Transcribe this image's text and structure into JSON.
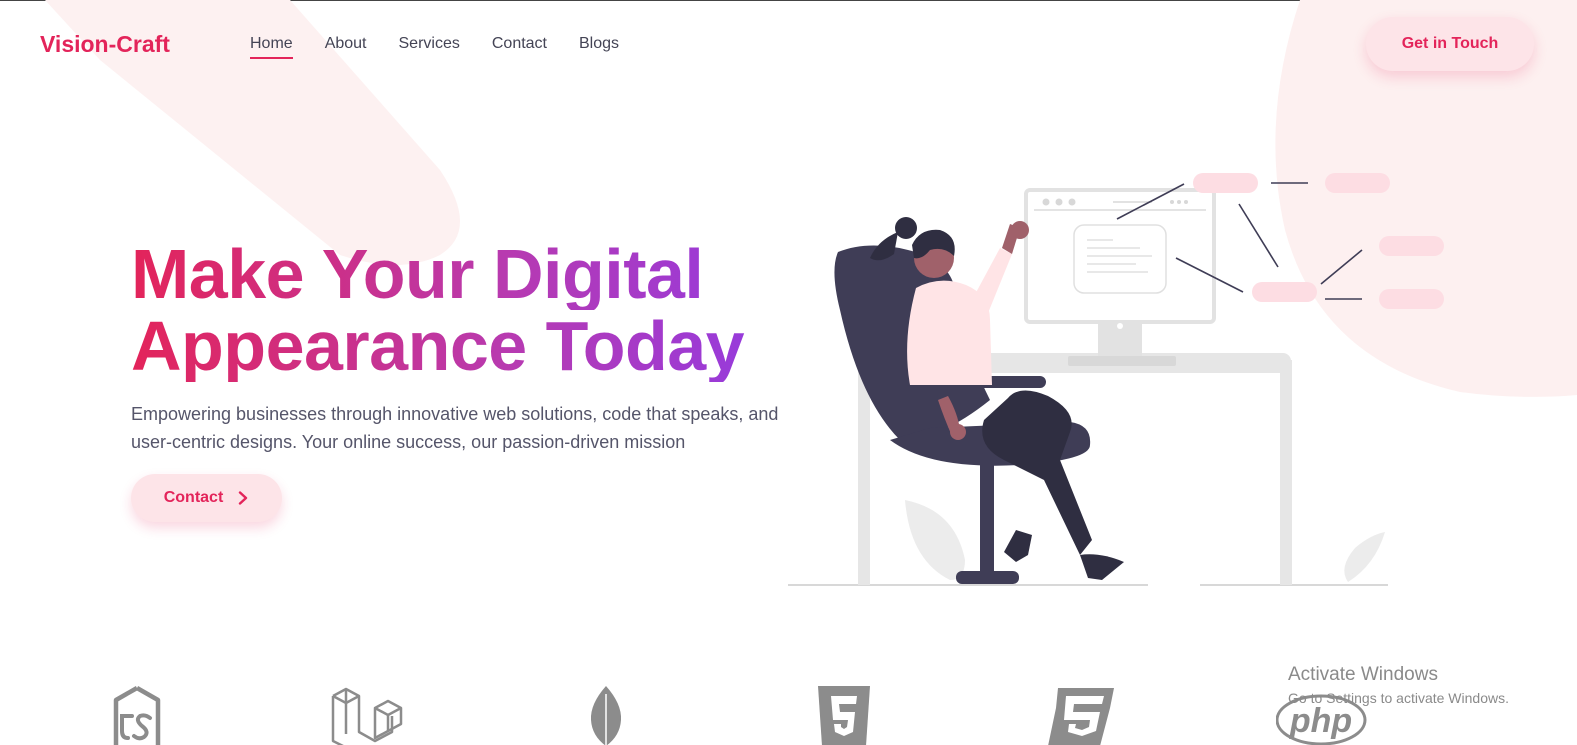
{
  "brand": "Vision-Craft",
  "nav": {
    "links": [
      "Home",
      "About",
      "Services",
      "Contact",
      "Blogs"
    ],
    "active": "Home",
    "cta_label": "Get in Touch"
  },
  "hero": {
    "title_line1": "Make Your Digital",
    "title_line2": "Appearance Today",
    "subtitle_line1": "Empowering businesses through innovative web solutions, code that speaks, and",
    "subtitle_line2": "user-centric designs. Your online success, our passion-driven mission",
    "button_label": "Contact",
    "button_icon": "chevron-right-icon"
  },
  "tech_logos": [
    {
      "name": "nodejs-icon"
    },
    {
      "name": "laravel-icon"
    },
    {
      "name": "mongodb-icon"
    },
    {
      "name": "html5-icon"
    },
    {
      "name": "css3-icon"
    },
    {
      "name": "php-icon",
      "text": "php"
    }
  ],
  "watermark": {
    "title": "Activate Windows",
    "subtitle": "Go to Settings to activate Windows."
  },
  "colors": {
    "accent": "#e3245a",
    "accent_soft": "#fde4e8",
    "gradient_end": "#8f3be6",
    "text": "#444455"
  }
}
